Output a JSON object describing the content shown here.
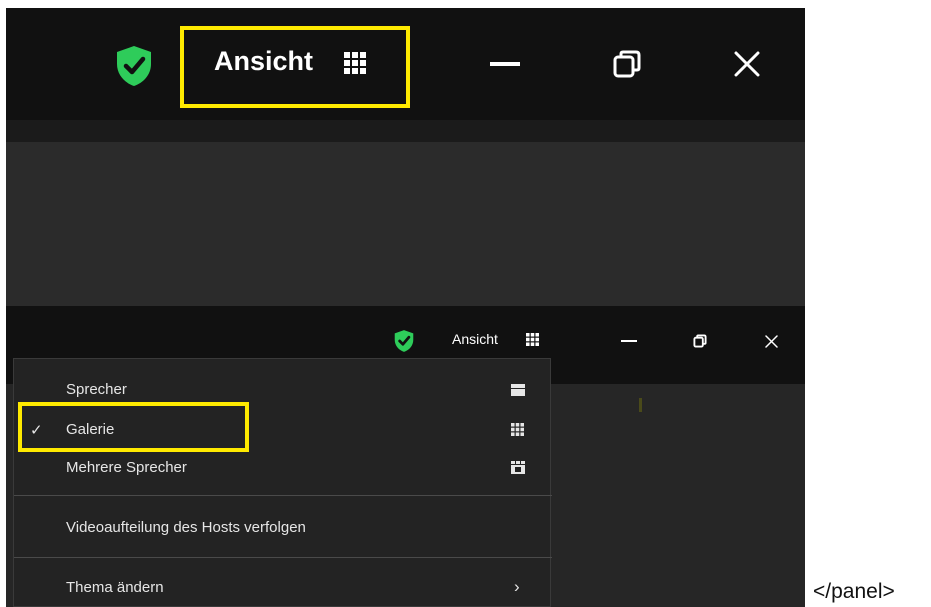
{
  "top_window": {
    "view_label": "Ansicht",
    "icons": {
      "security": "shield-check-icon",
      "view": "grid-icon",
      "minimize": "minimize-icon",
      "restore": "restore-icon",
      "close": "close-icon"
    }
  },
  "bottom_window": {
    "view_label": "Ansicht"
  },
  "view_menu": {
    "items": [
      {
        "label": "Sprecher",
        "checked": false,
        "icon": "speaker-layout-icon"
      },
      {
        "label": "Galerie",
        "checked": true,
        "icon": "gallery-layout-icon"
      },
      {
        "label": "Mehrere Sprecher",
        "checked": false,
        "icon": "multi-speaker-layout-icon"
      }
    ],
    "follow_host": "Videoaufteilung des Hosts verfolgen",
    "theme": "Thema ändern",
    "check_glyph": "✓",
    "submenu_glyph": "›"
  },
  "stray_text": "</panel>",
  "colors": {
    "highlight": "#ffea00",
    "shield": "#2ecc5a",
    "titlebar": "#111111"
  }
}
